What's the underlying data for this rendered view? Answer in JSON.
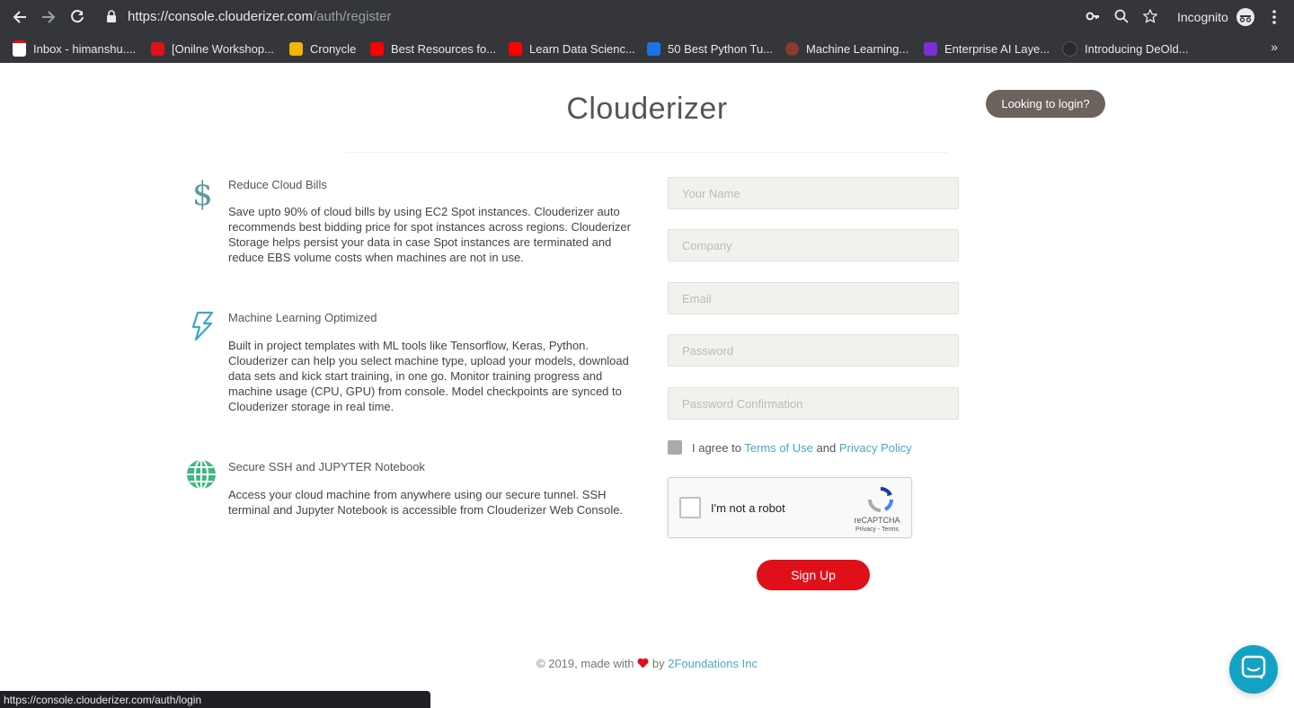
{
  "browser": {
    "url_main": "https://console.clouderizer.com",
    "url_path": "/auth/register",
    "incognito_label": "Incognito",
    "bookmarks": [
      {
        "label": "Inbox - himanshu....",
        "color": "#ffffff"
      },
      {
        "label": "[Onilne Workshop...",
        "color": "#e0101a"
      },
      {
        "label": "Cronycle",
        "color": "#f5b400"
      },
      {
        "label": "Best Resources fo...",
        "color": "#ff0000"
      },
      {
        "label": "Learn Data Scienc...",
        "color": "#ff0000"
      },
      {
        "label": "50 Best Python Tu...",
        "color": "#1a73e8"
      },
      {
        "label": "Machine Learning...",
        "color": "#8b3a2b"
      },
      {
        "label": "Enterprise AI Laye...",
        "color": "#7b2fd6"
      },
      {
        "label": "Introducing DeOld...",
        "color": "#2a2a2a"
      }
    ],
    "more_bookmarks": "»",
    "status_url": "https://console.clouderizer.com/auth/login"
  },
  "header": {
    "title": "Clouderizer",
    "login_button": "Looking to login?"
  },
  "features": [
    {
      "icon": "dollar-icon",
      "title": "Reduce Cloud Bills",
      "description": "Save upto 90% of cloud bills by using EC2 Spot instances. Clouderizer auto recommends best bidding price for spot instances across regions. Clouderizer Storage helps persist your data in case Spot instances are terminated and reduce EBS volume costs when machines are not in use."
    },
    {
      "icon": "lightning-icon",
      "title": "Machine Learning Optimized",
      "description": "Built in project templates with ML tools like Tensorflow, Keras, Python. Clouderizer can help you select machine type, upload your models, download data sets and kick start training, in one go. Monitor training progress and machine usage (CPU, GPU) from console. Model checkpoints are synced to Clouderizer storage in real time."
    },
    {
      "icon": "globe-icon",
      "title": "Secure SSH and JUPYTER Notebook",
      "description": "Access your cloud machine from anywhere using our secure tunnel. SSH terminal and Jupyter Notebook is accessible from Clouderizer Web Console."
    }
  ],
  "form": {
    "name_placeholder": "Your Name",
    "company_placeholder": "Company",
    "email_placeholder": "Email",
    "password_placeholder": "Password",
    "password_confirm_placeholder": "Password Confirmation",
    "agree_prefix": "I agree to",
    "terms_link": "Terms of Use",
    "agree_and": "and",
    "privacy_link": "Privacy Policy",
    "recaptcha_label": "I'm not a robot",
    "recaptcha_brand": "reCAPTCHA",
    "recaptcha_terms": "Privacy - Terms",
    "signup_button": "Sign Up"
  },
  "footer": {
    "prefix": "© 2019, made with",
    "by": "by",
    "company": "2Foundations Inc"
  },
  "colors": {
    "accent": "#4aa8c7",
    "signup": "#e0101a",
    "login_button": "#6b635d",
    "chat": "#14a2c4"
  }
}
